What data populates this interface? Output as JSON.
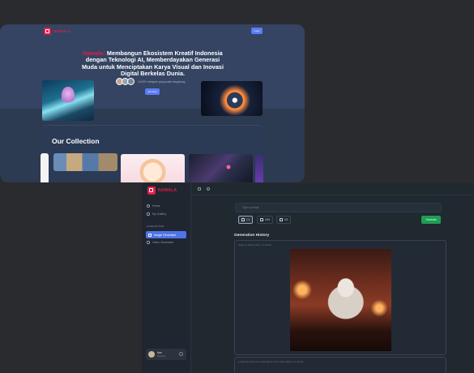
{
  "landing": {
    "logo_text": "NAWALA",
    "login_label": "Login",
    "hero": {
      "brand": "Nawala:",
      "title_rest": " Membangun Ekosistem Kreatif Indonesia dengan Teknologi AI, Memberdayakan Generasi Muda untuk Menciptakan Karya Visual dan Inovasi Digital Berkelas Dunia.",
      "subtext": "10.000+ designer yang sudah bergabung",
      "join_label": "Join Now"
    },
    "collection_title": "Our Collection"
  },
  "app": {
    "logo_text": "NAWALA",
    "sidebar": {
      "items": [
        {
          "label": "Home"
        },
        {
          "label": "My Gallery"
        }
      ],
      "section_label": "GENERATOR",
      "generators": [
        {
          "label": "Image Generator",
          "active": true
        },
        {
          "label": "Video Generator",
          "active": false
        }
      ],
      "user": {
        "name": "dan",
        "role": "Designer"
      }
    },
    "prompt": {
      "placeholder": "Type a prompt"
    },
    "ratios": [
      {
        "label": "1:1",
        "selected": true
      },
      {
        "label": "16:9",
        "selected": false
      },
      {
        "label": "3:5",
        "selected": false
      }
    ],
    "generate_label": "Generate",
    "history": {
      "title": "Generation History",
      "entry_meta": "ninja in a ramen shop, 1:1 format",
      "entry2_meta": "a cinematic shot of a mystic figure in the night market, 1:1 format"
    }
  },
  "colors": {
    "brand": "#e11d48",
    "accent": "#5b7cf5",
    "generate": "#1f9d55"
  }
}
